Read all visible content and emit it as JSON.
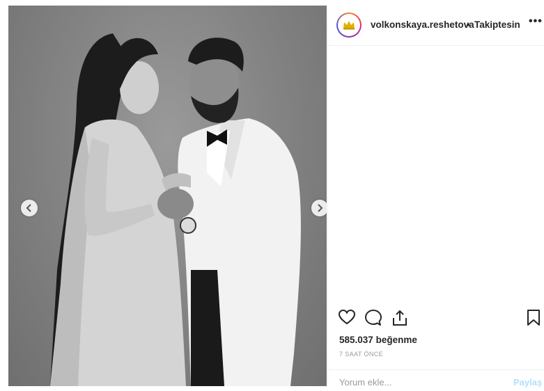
{
  "post": {
    "username": "volkonskaya.reshetova",
    "separator": "•",
    "follow_status": "Takiptesin",
    "more_icon": "more-options-icon",
    "likes_count": "585.037",
    "likes_label": "beğenme",
    "timestamp": "7 SAAT ÖNCE",
    "comment_placeholder": "Yorum ekle...",
    "share_label": "Paylaş"
  },
  "icons": {
    "like": "heart-icon",
    "comment": "comment-icon",
    "share": "share-icon",
    "save": "bookmark-icon",
    "prev": "chevron-left-icon",
    "next": "chevron-right-icon"
  },
  "colors": {
    "avatar_crown": "#e0b000",
    "link_disabled": "#b2dffc",
    "muted": "#999999",
    "text": "#262626"
  }
}
